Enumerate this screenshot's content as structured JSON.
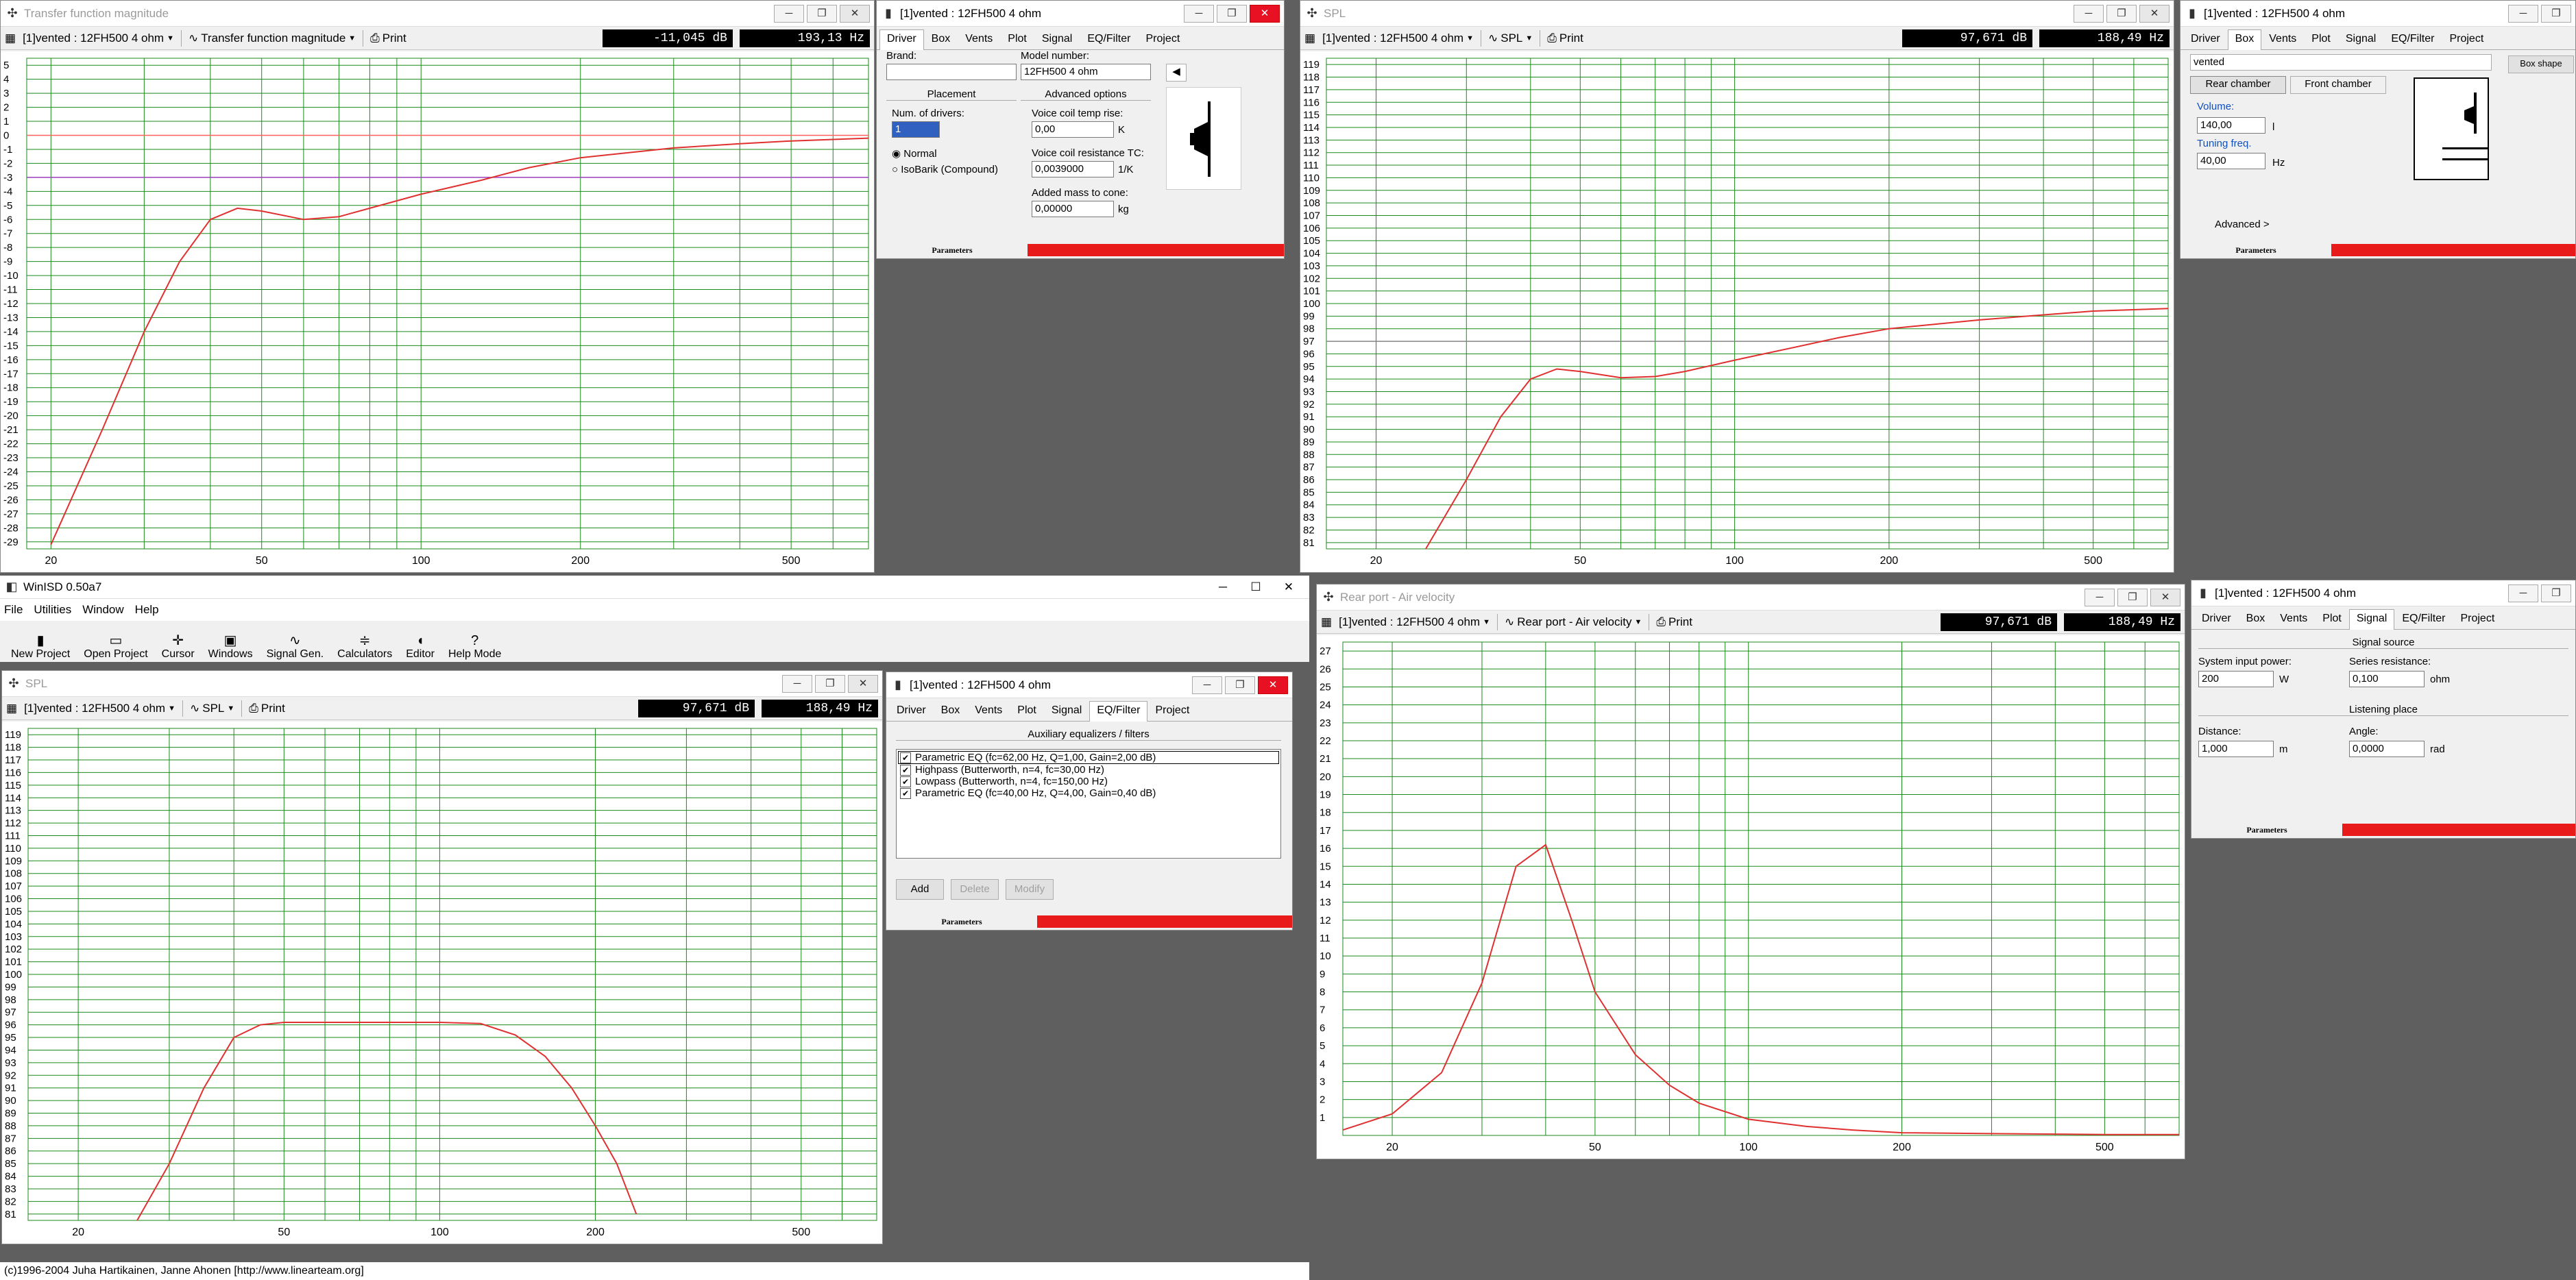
{
  "win_tf": {
    "title": "Transfer function magnitude",
    "project": "[1]vented : 12FH500 4 ohm",
    "plot_select": "Transfer function magnitude",
    "print_label": "Print",
    "readout_db": "-11,045 dB",
    "readout_hz": "193,13 Hz"
  },
  "win_driver": {
    "title": "[1]vented : 12FH500 4 ohm",
    "tabs": [
      "Driver",
      "Box",
      "Vents",
      "Plot",
      "Signal",
      "EQ/Filter",
      "Project"
    ],
    "brand_label": "Brand:",
    "brand_value": "",
    "model_label": "Model number:",
    "model_value": "12FH500 4 ohm",
    "placement_label": "Placement",
    "advanced_label": "Advanced options",
    "num_drivers_label": "Num. of drivers:",
    "num_drivers_value": "1",
    "normal_label": "Normal",
    "isobarik_label": "IsoBarik (Compound)",
    "vc_temp_label": "Voice coil temp rise:",
    "vc_temp_value": "0,00",
    "vc_temp_unit": "K",
    "vc_res_label": "Voice coil resistance TC:",
    "vc_res_value": "0,0039000",
    "vc_res_unit": "1/K",
    "mass_label": "Added mass to cone:",
    "mass_value": "0,00000",
    "mass_unit": "kg",
    "status": "Parameters"
  },
  "win_spl_top": {
    "title": "SPL",
    "project": "[1]vented : 12FH500 4 ohm",
    "plot_select": "SPL",
    "print_label": "Print",
    "readout_db": "97,671 dB",
    "readout_hz": "188,49 Hz"
  },
  "win_box": {
    "title": "[1]vented : 12FH500 4 ohm",
    "tabs": [
      "Driver",
      "Box",
      "Vents",
      "Plot",
      "Signal",
      "EQ/Filter",
      "Project"
    ],
    "box_type": "vented",
    "box_shape_btn": "Box shape",
    "rear_label": "Rear chamber",
    "front_label": "Front chamber",
    "volume_label": "Volume:",
    "volume_value": "140,00",
    "volume_unit": "l",
    "tuning_label": "Tuning freq.",
    "tuning_value": "40,00",
    "tuning_unit": "Hz",
    "advanced_label": "Advanced >",
    "status": "Parameters"
  },
  "main": {
    "title": "WinISD 0.50a7",
    "menus": [
      "File",
      "Utilities",
      "Window",
      "Help"
    ],
    "toolbar": [
      {
        "label": "New Project",
        "icon": "new-project-icon",
        "glyph": "▮"
      },
      {
        "label": "Open Project",
        "icon": "open-project-icon",
        "glyph": "▭"
      },
      {
        "label": "Cursor",
        "icon": "cursor-icon",
        "glyph": "✛"
      },
      {
        "label": "Windows",
        "icon": "windows-icon",
        "glyph": "▣"
      },
      {
        "label": "Signal Gen.",
        "icon": "signal-gen-icon",
        "glyph": "∿"
      },
      {
        "label": "Calculators",
        "icon": "calculators-icon",
        "glyph": "≑"
      },
      {
        "label": "Editor",
        "icon": "editor-icon",
        "glyph": "◖"
      },
      {
        "label": "Help Mode",
        "icon": "help-icon",
        "glyph": "?"
      }
    ],
    "status": "(c)1996-2004 Juha Hartikainen, Janne Ahonen [http://www.linearteam.org]"
  },
  "win_spl_bot": {
    "title": "SPL",
    "project": "[1]vented : 12FH500 4 ohm",
    "plot_select": "SPL",
    "print_label": "Print",
    "readout_db": "97,671 dB",
    "readout_hz": "188,49 Hz"
  },
  "win_eq": {
    "title": "[1]vented : 12FH500 4 ohm",
    "tabs": [
      "Driver",
      "Box",
      "Vents",
      "Plot",
      "Signal",
      "EQ/Filter",
      "Project"
    ],
    "group_label": "Auxiliary equalizers / filters",
    "items": [
      "Parametric EQ (fc=62,00 Hz, Q=1,00, Gain=2,00 dB)",
      "Highpass (Butterworth, n=4, fc=30,00 Hz)",
      "Lowpass (Butterworth, n=4, fc=150,00 Hz)",
      "Parametric EQ (fc=40,00 Hz, Q=4,00, Gain=0,40 dB)"
    ],
    "add": "Add",
    "delete": "Delete",
    "modify": "Modify",
    "status": "Parameters"
  },
  "win_vel": {
    "title": "Rear port - Air velocity",
    "project": "[1]vented : 12FH500 4 ohm",
    "plot_select": "Rear port - Air velocity",
    "print_label": "Print",
    "readout_db": "97,671 dB",
    "readout_hz": "188,49 Hz"
  },
  "win_sig": {
    "title": "[1]vented : 12FH500 4 ohm",
    "tabs": [
      "Driver",
      "Box",
      "Vents",
      "Plot",
      "Signal",
      "EQ/Filter",
      "Project"
    ],
    "source_label": "Signal source",
    "power_label": "System input power:",
    "power_value": "200",
    "power_unit": "W",
    "series_label": "Series resistance:",
    "series_value": "0,100",
    "series_unit": "ohm",
    "listen_label": "Listening place",
    "distance_label": "Distance:",
    "distance_value": "1,000",
    "distance_unit": "m",
    "angle_label": "Angle:",
    "angle_value": "0,0000",
    "angle_unit": "rad",
    "status": "Parameters"
  },
  "chart_data": [
    {
      "type": "line",
      "title": "Transfer function magnitude",
      "x_scale": "log",
      "xlim": [
        18,
        700
      ],
      "ylim": [
        -29.5,
        5.5
      ],
      "x_ticks": [
        20,
        50,
        100,
        200,
        500
      ],
      "y_ticks": [
        5,
        4,
        3,
        2,
        1,
        0,
        -1,
        -2,
        -3,
        -4,
        -5,
        -6,
        -7,
        -8,
        -9,
        -10,
        -11,
        -12,
        -13,
        -14,
        -15,
        -16,
        -17,
        -18,
        -19,
        -20,
        -21,
        -22,
        -23,
        -24,
        -25,
        -26,
        -27,
        -28,
        -29
      ],
      "ref_lines": [
        {
          "y": 0,
          "color": "#ff6060"
        },
        {
          "y": -3,
          "color": "#a040c0"
        }
      ],
      "series": [
        {
          "color": "#e03030",
          "x": [
            20,
            25,
            30,
            35,
            40,
            45,
            50,
            60,
            70,
            80,
            100,
            130,
            160,
            200,
            300,
            400,
            500,
            700
          ],
          "y": [
            -29.2,
            -21,
            -14,
            -9,
            -6,
            -5.2,
            -5.4,
            -6,
            -5.8,
            -5.2,
            -4.2,
            -3.2,
            -2.3,
            -1.6,
            -0.9,
            -0.6,
            -0.4,
            -0.2
          ]
        }
      ]
    },
    {
      "type": "line",
      "title": "SPL",
      "x_scale": "log",
      "xlim": [
        16,
        700
      ],
      "ylim": [
        80.5,
        119.5
      ],
      "x_ticks": [
        20,
        50,
        100,
        200,
        500
      ],
      "y_ticks": [
        119,
        118,
        117,
        116,
        115,
        114,
        113,
        112,
        111,
        110,
        109,
        108,
        107,
        106,
        105,
        104,
        103,
        102,
        101,
        100,
        99,
        98,
        97,
        96,
        95,
        94,
        93,
        92,
        91,
        90,
        89,
        88,
        87,
        86,
        85,
        84,
        83,
        82,
        81
      ],
      "ref_lines": [
        {
          "y": 97,
          "color": "#888888"
        }
      ],
      "series": [
        {
          "color": "#e03030",
          "x": [
            25,
            30,
            35,
            40,
            45,
            50,
            60,
            70,
            80,
            100,
            130,
            160,
            200,
            300,
            400,
            500,
            700
          ],
          "y": [
            80.5,
            86,
            91,
            94,
            94.8,
            94.6,
            94.1,
            94.2,
            94.6,
            95.5,
            96.5,
            97.3,
            98,
            98.7,
            99.1,
            99.4,
            99.6
          ]
        }
      ]
    },
    {
      "type": "line",
      "title": "SPL",
      "x_scale": "log",
      "xlim": [
        16,
        700
      ],
      "ylim": [
        80.5,
        119.5
      ],
      "x_ticks": [
        20,
        50,
        100,
        200,
        500
      ],
      "y_ticks": [
        119,
        118,
        117,
        116,
        115,
        114,
        113,
        112,
        111,
        110,
        109,
        108,
        107,
        106,
        105,
        104,
        103,
        102,
        101,
        100,
        99,
        98,
        97,
        96,
        95,
        94,
        93,
        92,
        91,
        90,
        89,
        88,
        87,
        86,
        85,
        84,
        83,
        82,
        81
      ],
      "ref_lines": [],
      "series": [
        {
          "color": "#e03030",
          "x": [
            26,
            30,
            35,
            40,
            45,
            50,
            60,
            80,
            100,
            120,
            140,
            160,
            180,
            200,
            220,
            240
          ],
          "y": [
            80.5,
            85,
            91,
            95,
            96,
            96.2,
            96.2,
            96.2,
            96.2,
            96.1,
            95.2,
            93.5,
            91,
            88,
            85,
            81
          ]
        }
      ]
    },
    {
      "type": "line",
      "title": "Rear port - Air velocity",
      "x_scale": "log",
      "xlim": [
        16,
        700
      ],
      "ylim": [
        0,
        27.5
      ],
      "x_ticks": [
        20,
        50,
        100,
        200,
        500
      ],
      "y_ticks": [
        27,
        26,
        25,
        24,
        23,
        22,
        21,
        20,
        19,
        18,
        17,
        16,
        15,
        14,
        13,
        12,
        11,
        10,
        9,
        8,
        7,
        6,
        5,
        4,
        3,
        2,
        1
      ],
      "ref_lines": [],
      "series": [
        {
          "color": "#e03030",
          "x": [
            16,
            20,
            25,
            30,
            35,
            40,
            45,
            50,
            60,
            70,
            80,
            100,
            130,
            160,
            200,
            300,
            500,
            700
          ],
          "y": [
            0.3,
            1.2,
            3.5,
            8.5,
            15,
            16.2,
            12,
            8,
            4.5,
            2.8,
            1.8,
            0.9,
            0.5,
            0.3,
            0.15,
            0.1,
            0.05,
            0.05
          ]
        }
      ]
    }
  ]
}
